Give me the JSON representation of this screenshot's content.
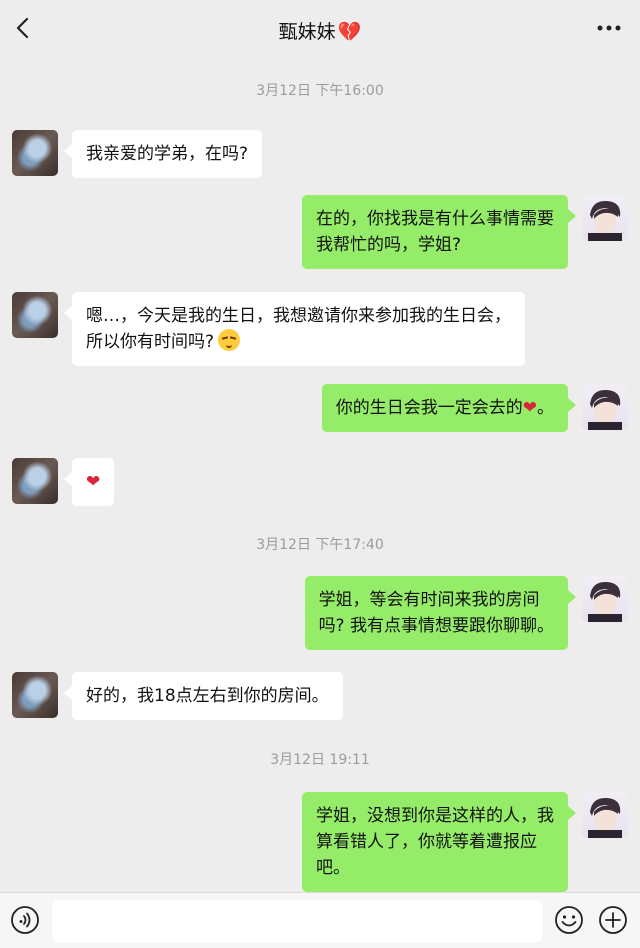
{
  "header": {
    "title": "甄妹妹",
    "title_emoji": "💔",
    "back_icon": "chevron-left-icon",
    "more_icon": "more-icon"
  },
  "timestamps": [
    "3月12日 下午16:00",
    "3月12日 下午17:40",
    "3月12日 19:11"
  ],
  "messages": [
    {
      "side": "left",
      "text": "我亲爱的学弟，在吗?"
    },
    {
      "side": "right",
      "line1": "在的，你找我是有什么事情需要",
      "line2": "我帮忙的吗，学姐?"
    },
    {
      "side": "left",
      "line1": "嗯…，今天是我的生日，我想邀请你来参加我的生日会，",
      "line2": "所以你有时间吗?"
    },
    {
      "side": "right",
      "text": "你的生日会我一定会去的",
      "suffix": "。"
    },
    {
      "side": "left",
      "text": "❤"
    },
    {
      "side": "right",
      "line1": "学姐，等会有时间来我的房间",
      "line2": "吗? 我有点事情想要跟你聊聊。"
    },
    {
      "side": "left",
      "text": "好的，我18点左右到你的房间。"
    },
    {
      "side": "right",
      "line1": "学姐，没想到你是这样的人，我",
      "line2": "算看错人了，你就等着遭报应",
      "line3": "吧。"
    }
  ],
  "emojis": {
    "heart": "❤",
    "face": "shy-face-emoji"
  },
  "input": {
    "placeholder": "",
    "value": ""
  },
  "icons": {
    "voice": "voice-icon",
    "emoji": "emoji-icon",
    "plus": "plus-icon"
  },
  "colors": {
    "background": "#ededed",
    "bubble_sent": "#95ec69",
    "bubble_received": "#ffffff",
    "timestamp": "#9c9c9c"
  }
}
